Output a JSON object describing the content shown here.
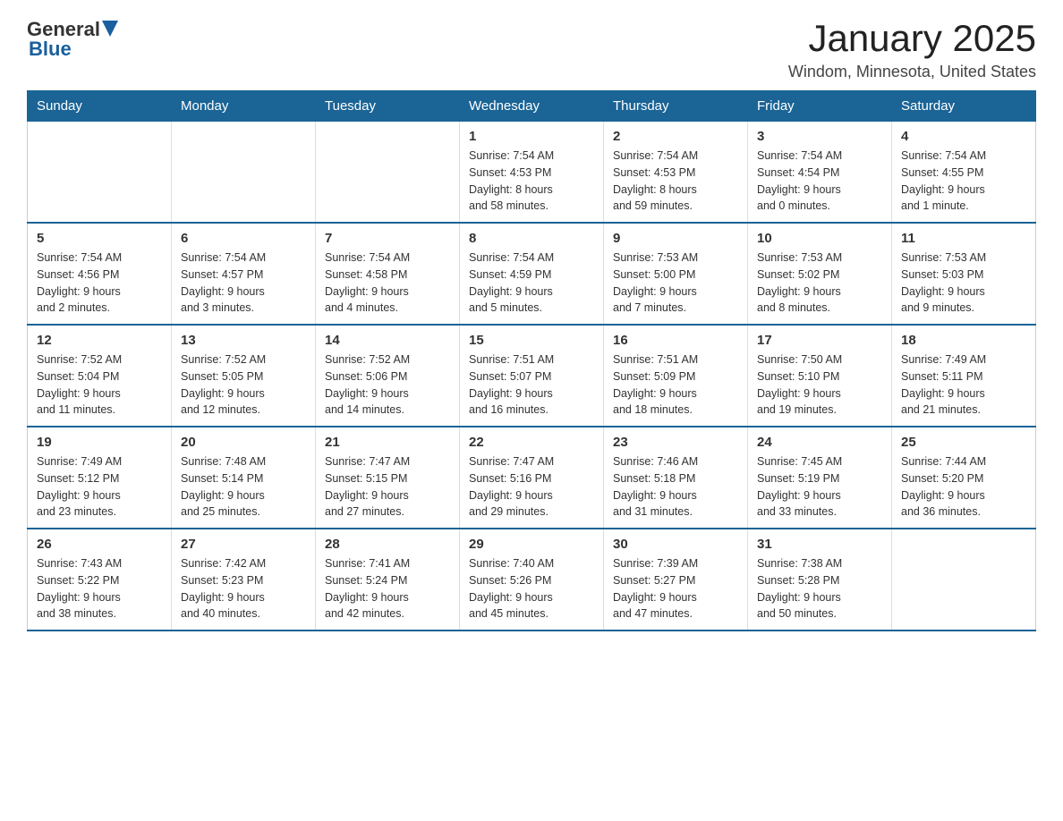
{
  "header": {
    "logo_general": "General",
    "logo_blue": "Blue",
    "month_title": "January 2025",
    "location": "Windom, Minnesota, United States"
  },
  "weekdays": [
    "Sunday",
    "Monday",
    "Tuesday",
    "Wednesday",
    "Thursday",
    "Friday",
    "Saturday"
  ],
  "weeks": [
    [
      {
        "day": "",
        "info": ""
      },
      {
        "day": "",
        "info": ""
      },
      {
        "day": "",
        "info": ""
      },
      {
        "day": "1",
        "info": "Sunrise: 7:54 AM\nSunset: 4:53 PM\nDaylight: 8 hours\nand 58 minutes."
      },
      {
        "day": "2",
        "info": "Sunrise: 7:54 AM\nSunset: 4:53 PM\nDaylight: 8 hours\nand 59 minutes."
      },
      {
        "day": "3",
        "info": "Sunrise: 7:54 AM\nSunset: 4:54 PM\nDaylight: 9 hours\nand 0 minutes."
      },
      {
        "day": "4",
        "info": "Sunrise: 7:54 AM\nSunset: 4:55 PM\nDaylight: 9 hours\nand 1 minute."
      }
    ],
    [
      {
        "day": "5",
        "info": "Sunrise: 7:54 AM\nSunset: 4:56 PM\nDaylight: 9 hours\nand 2 minutes."
      },
      {
        "day": "6",
        "info": "Sunrise: 7:54 AM\nSunset: 4:57 PM\nDaylight: 9 hours\nand 3 minutes."
      },
      {
        "day": "7",
        "info": "Sunrise: 7:54 AM\nSunset: 4:58 PM\nDaylight: 9 hours\nand 4 minutes."
      },
      {
        "day": "8",
        "info": "Sunrise: 7:54 AM\nSunset: 4:59 PM\nDaylight: 9 hours\nand 5 minutes."
      },
      {
        "day": "9",
        "info": "Sunrise: 7:53 AM\nSunset: 5:00 PM\nDaylight: 9 hours\nand 7 minutes."
      },
      {
        "day": "10",
        "info": "Sunrise: 7:53 AM\nSunset: 5:02 PM\nDaylight: 9 hours\nand 8 minutes."
      },
      {
        "day": "11",
        "info": "Sunrise: 7:53 AM\nSunset: 5:03 PM\nDaylight: 9 hours\nand 9 minutes."
      }
    ],
    [
      {
        "day": "12",
        "info": "Sunrise: 7:52 AM\nSunset: 5:04 PM\nDaylight: 9 hours\nand 11 minutes."
      },
      {
        "day": "13",
        "info": "Sunrise: 7:52 AM\nSunset: 5:05 PM\nDaylight: 9 hours\nand 12 minutes."
      },
      {
        "day": "14",
        "info": "Sunrise: 7:52 AM\nSunset: 5:06 PM\nDaylight: 9 hours\nand 14 minutes."
      },
      {
        "day": "15",
        "info": "Sunrise: 7:51 AM\nSunset: 5:07 PM\nDaylight: 9 hours\nand 16 minutes."
      },
      {
        "day": "16",
        "info": "Sunrise: 7:51 AM\nSunset: 5:09 PM\nDaylight: 9 hours\nand 18 minutes."
      },
      {
        "day": "17",
        "info": "Sunrise: 7:50 AM\nSunset: 5:10 PM\nDaylight: 9 hours\nand 19 minutes."
      },
      {
        "day": "18",
        "info": "Sunrise: 7:49 AM\nSunset: 5:11 PM\nDaylight: 9 hours\nand 21 minutes."
      }
    ],
    [
      {
        "day": "19",
        "info": "Sunrise: 7:49 AM\nSunset: 5:12 PM\nDaylight: 9 hours\nand 23 minutes."
      },
      {
        "day": "20",
        "info": "Sunrise: 7:48 AM\nSunset: 5:14 PM\nDaylight: 9 hours\nand 25 minutes."
      },
      {
        "day": "21",
        "info": "Sunrise: 7:47 AM\nSunset: 5:15 PM\nDaylight: 9 hours\nand 27 minutes."
      },
      {
        "day": "22",
        "info": "Sunrise: 7:47 AM\nSunset: 5:16 PM\nDaylight: 9 hours\nand 29 minutes."
      },
      {
        "day": "23",
        "info": "Sunrise: 7:46 AM\nSunset: 5:18 PM\nDaylight: 9 hours\nand 31 minutes."
      },
      {
        "day": "24",
        "info": "Sunrise: 7:45 AM\nSunset: 5:19 PM\nDaylight: 9 hours\nand 33 minutes."
      },
      {
        "day": "25",
        "info": "Sunrise: 7:44 AM\nSunset: 5:20 PM\nDaylight: 9 hours\nand 36 minutes."
      }
    ],
    [
      {
        "day": "26",
        "info": "Sunrise: 7:43 AM\nSunset: 5:22 PM\nDaylight: 9 hours\nand 38 minutes."
      },
      {
        "day": "27",
        "info": "Sunrise: 7:42 AM\nSunset: 5:23 PM\nDaylight: 9 hours\nand 40 minutes."
      },
      {
        "day": "28",
        "info": "Sunrise: 7:41 AM\nSunset: 5:24 PM\nDaylight: 9 hours\nand 42 minutes."
      },
      {
        "day": "29",
        "info": "Sunrise: 7:40 AM\nSunset: 5:26 PM\nDaylight: 9 hours\nand 45 minutes."
      },
      {
        "day": "30",
        "info": "Sunrise: 7:39 AM\nSunset: 5:27 PM\nDaylight: 9 hours\nand 47 minutes."
      },
      {
        "day": "31",
        "info": "Sunrise: 7:38 AM\nSunset: 5:28 PM\nDaylight: 9 hours\nand 50 minutes."
      },
      {
        "day": "",
        "info": ""
      }
    ]
  ]
}
